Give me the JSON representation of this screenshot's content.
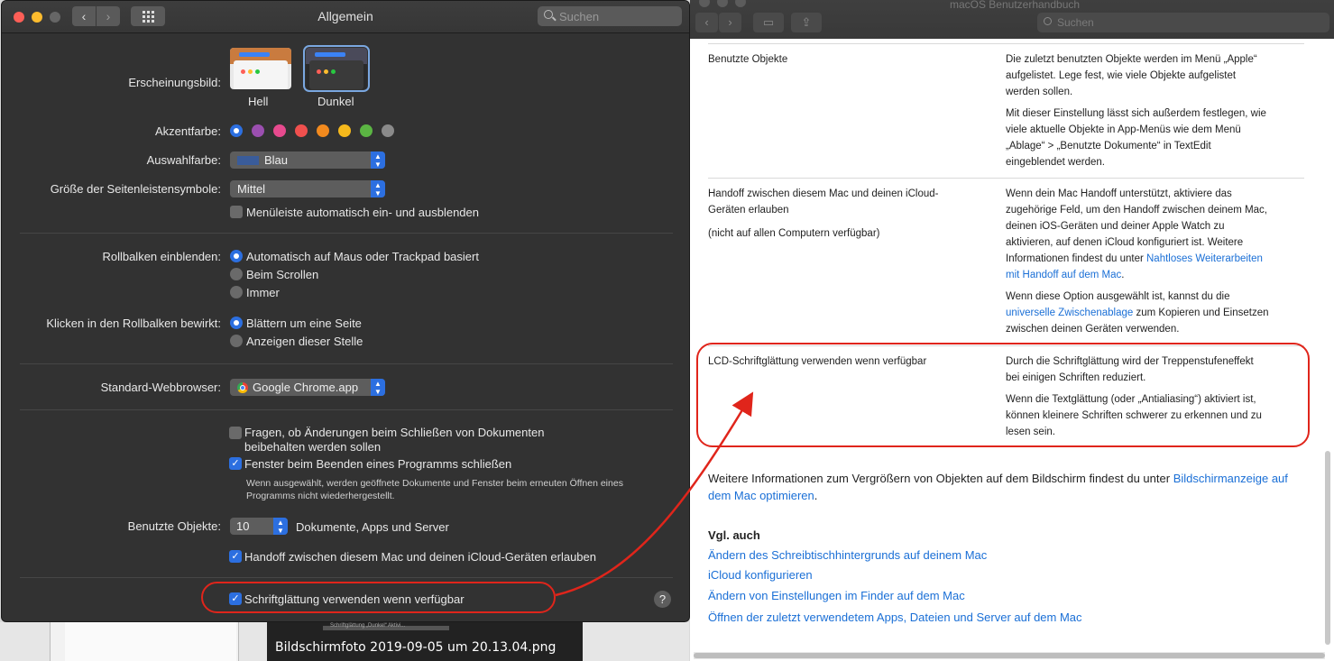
{
  "prefs": {
    "title": "Allgemein",
    "search_placeholder": "Suchen",
    "appearance_label": "Erscheinungsbild:",
    "appearance_options": [
      "Hell",
      "Dunkel"
    ],
    "accent_label": "Akzentfarbe:",
    "accent_colors": [
      "#2c6fe0",
      "#9b4fb0",
      "#e74a8e",
      "#f0504e",
      "#f28a1e",
      "#f6b91c",
      "#5bb543",
      "#8a8a8a"
    ],
    "highlight_label": "Auswahlfarbe:",
    "highlight_value": "Blau",
    "sidebar_label": "Größe der Seitenleistensymbole:",
    "sidebar_value": "Mittel",
    "menubar_label": "Menüleiste automatisch ein- und ausblenden",
    "scrollbars_label": "Rollbalken einblenden:",
    "scrollbar_options": [
      "Automatisch auf Maus oder Trackpad basiert",
      "Beim Scrollen",
      "Immer"
    ],
    "click_label": "Klicken in den Rollbalken bewirkt:",
    "click_options": [
      "Blättern um eine Seite",
      "Anzeigen dieser Stelle"
    ],
    "browser_label": "Standard-Webbrowser:",
    "browser_value": "Google Chrome.app",
    "ask_keep_changes": "Fragen, ob Änderungen beim Schließen von Dokumenten",
    "ask_keep_changes_2": "beibehalten werden sollen",
    "close_windows": "Fenster beim Beenden eines Programms schließen",
    "close_windows_note_1": "Wenn ausgewählt, werden geöffnete Dokumente und Fenster beim erneuten Öffnen eines",
    "close_windows_note_2": "Programms nicht wiederhergestellt.",
    "recent_label": "Benutzte Objekte:",
    "recent_value": "10",
    "recent_suffix": "Dokumente, Apps und Server",
    "handoff": "Handoff zwischen diesem Mac und deinen iCloud-Geräten erlauben",
    "font_smoothing": "Schriftglättung verwenden wenn verfügbar",
    "help_symbol": "?"
  },
  "desktop": {
    "caption": "Bildschirmfoto 2019-09-05 um 20.13.04.png",
    "mini_caption": "Schriftglättung „Dunkel“ Aktivi..."
  },
  "help": {
    "title": "macOS Benutzerhandbuch",
    "search_placeholder": "Suchen",
    "rows": [
      {
        "term": "Benutzte Objekte",
        "desc1": "Die zuletzt benutzten Objekte werden im Menü „Apple“",
        "desc2": "aufgelistet. Lege fest, wie viele Objekte aufgelistet",
        "desc3": "werden sollen.",
        "desc4": "Mit dieser Einstellung lässt sich außerdem festlegen, wie",
        "desc5": "viele aktuelle Objekte in App-Menüs wie dem Menü",
        "desc6": "„Ablage“ > „Benutzte Dokumente“ in TextEdit",
        "desc7": "eingeblendet werden."
      },
      {
        "term1": "Handoff zwischen diesem Mac und deinen iCloud-",
        "term2": "Geräten erlauben",
        "term3": "(nicht auf allen Computern verfügbar)",
        "desc1": "Wenn dein Mac Handoff unterstützt, aktiviere das",
        "desc2": "zugehörige Feld, um den Handoff zwischen deinem Mac,",
        "desc3": "deinen iOS-Geräten und deiner Apple Watch zu",
        "desc4": "aktivieren, auf denen iCloud konfiguriert ist. Weitere",
        "desc5": "Informationen findest du unter",
        "link1": "Nahtloses Weiterarbeiten",
        "link2": "mit Handoff auf dem Mac",
        "desc6": "Wenn diese Option ausgewählt ist, kannst du die",
        "link3": "universelle Zwischenablage",
        "desc7": "zum Kopieren und Einsetzen",
        "desc8": "zwischen deinen Geräten verwenden."
      },
      {
        "term": "LCD-Schriftglättung verwenden wenn verfügbar",
        "desc1": "Durch die Schriftglättung wird der Treppenstufeneffekt",
        "desc2": "bei einigen Schriften reduziert.",
        "desc3": "Wenn die Textglättung (oder „Antialiasing“) aktiviert ist,",
        "desc4": "können kleinere Schriften schwerer zu erkennen und zu",
        "desc5": "lesen sein."
      }
    ],
    "more_info": "Weitere Informationen zum Vergrößern von Objekten auf dem Bildschirm findest du unter",
    "more_info_link1": "Bildschirmanzeige",
    "more_info_link2": "auf dem Mac optimieren",
    "see_also": "Vgl. auch",
    "see_also_links": [
      "Ändern des Schreibtischhintergrunds auf deinem Mac",
      "iCloud konfigurieren",
      "Ändern von Einstellungen im Finder auf dem Mac",
      "Öffnen der zuletzt verwendetem Apps, Dateien und Server auf dem Mac"
    ]
  },
  "colors": {
    "accent": "#2c6fe0",
    "annotation": "#e0251b",
    "link": "#1a6fd6"
  }
}
